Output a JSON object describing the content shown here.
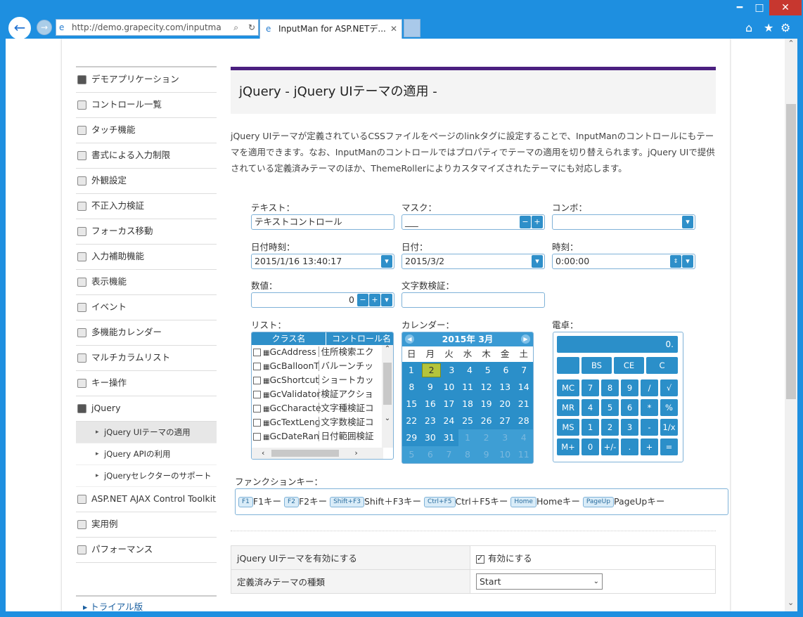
{
  "browser": {
    "url": "http://demo.grapecity.com/inputma",
    "tab_title": "InputMan for ASP.NETデ...",
    "tab_close": "✕",
    "window_controls": {
      "minimize": "━",
      "maximize": "□",
      "close": "✕"
    },
    "icons": [
      "home-icon",
      "favorites-icon",
      "tools-icon"
    ]
  },
  "sidebar": {
    "items": [
      {
        "label": "デモアプリケーション"
      },
      {
        "label": "コントロール一覧"
      },
      {
        "label": "タッチ機能"
      },
      {
        "label": "書式による入力制限"
      },
      {
        "label": "外観設定"
      },
      {
        "label": "不正入力検証"
      },
      {
        "label": "フォーカス移動"
      },
      {
        "label": "入力補助機能"
      },
      {
        "label": "表示機能"
      },
      {
        "label": "イベント"
      },
      {
        "label": "多機能カレンダー"
      },
      {
        "label": "マルチカラムリスト"
      },
      {
        "label": "キー操作"
      },
      {
        "label": "jQuery"
      }
    ],
    "sub_items": [
      {
        "label": "jQuery UIテーマの適用"
      },
      {
        "label": "jQuery APIの利用"
      },
      {
        "label": "jQueryセレクターのサポート"
      }
    ],
    "more_items": [
      {
        "label": "ASP.NET AJAX Control Toolkit"
      },
      {
        "label": "実用例"
      },
      {
        "label": "パフォーマンス"
      }
    ],
    "trial": "トライアル版"
  },
  "main": {
    "title": "jQuery - jQuery UIテーマの適用 -",
    "description": "jQuery UIテーマが定義されているCSSファイルをページのlinkタグに設定することで、InputManのコントロールにもテーマを適用できます。なお、InputManのコントロールではプロパティでテーマの適用を切り替えられます。jQuery UIで提供されている定義済みテーマのほか、ThemeRollerによりカスタマイズされたテーマにも対応します。"
  },
  "form": {
    "text_label": "テキスト：",
    "text_value": "テキストコントロール",
    "mask_label": "マスク：",
    "mask_value": "___",
    "combo_label": "コンボ：",
    "datetime_label": "日付時刻：",
    "datetime_value": "2015/1/16 13:40:17",
    "date_label": "日付：",
    "date_value": "2015/3/2",
    "time_label": "時刻：",
    "time_value": "0:00:00",
    "number_label": "数値：",
    "number_value": "0",
    "charcount_label": "文字数検証：",
    "list_label": "リスト：",
    "calendar_label": "カレンダー：",
    "calc_label": "電卓：",
    "fkeys_label": "ファンクションキー："
  },
  "list": {
    "headers": [
      "クラス名",
      "コントロール名"
    ],
    "rows": [
      {
        "cls": "GcAddress",
        "name": "住所検索エク"
      },
      {
        "cls": "GcBalloonT",
        "name": "バルーンチッ"
      },
      {
        "cls": "GcShortcut",
        "name": "ショートカッ"
      },
      {
        "cls": "GcValidator",
        "name": "検証アクショ"
      },
      {
        "cls": "GcCharacte",
        "name": "文字種検証コ"
      },
      {
        "cls": "GcTextLeng",
        "name": "文字数検証コ"
      },
      {
        "cls": "GcDateRan",
        "name": "日付範囲検証"
      }
    ]
  },
  "calendar": {
    "title": "2015年 3月",
    "days": [
      "日",
      "月",
      "火",
      "水",
      "木",
      "金",
      "土"
    ],
    "weeks": [
      [
        "1",
        "2",
        "3",
        "4",
        "5",
        "6",
        "7"
      ],
      [
        "8",
        "9",
        "10",
        "11",
        "12",
        "13",
        "14"
      ],
      [
        "15",
        "16",
        "17",
        "18",
        "19",
        "20",
        "21"
      ],
      [
        "22",
        "23",
        "24",
        "25",
        "26",
        "27",
        "28"
      ],
      [
        "29",
        "30",
        "31",
        "1",
        "2",
        "3",
        "4"
      ],
      [
        "5",
        "6",
        "7",
        "8",
        "9",
        "10",
        "11"
      ]
    ],
    "selected": "2"
  },
  "calculator": {
    "display": "0.",
    "rows": [
      [
        "",
        "BS",
        "CE",
        "C"
      ],
      [
        "MC",
        "7",
        "8",
        "9",
        "/",
        "√"
      ],
      [
        "MR",
        "4",
        "5",
        "6",
        "*",
        "%"
      ],
      [
        "MS",
        "1",
        "2",
        "3",
        "-",
        "1/x"
      ],
      [
        "M+",
        "0",
        "+/-",
        ".",
        "+",
        "="
      ]
    ]
  },
  "function_keys": [
    {
      "key": "F1",
      "label": "F1キー"
    },
    {
      "key": "F2",
      "label": "F2キー"
    },
    {
      "key": "Shift+F3",
      "label": "Shift＋F3キー"
    },
    {
      "key": "Ctrl+F5",
      "label": "Ctrl＋F5キー"
    },
    {
      "key": "Home",
      "label": "Homeキー"
    },
    {
      "key": "PageUp",
      "label": "PageUpキー"
    }
  ],
  "settings": {
    "enable_label": "jQuery UIテーマを有効にする",
    "enable_text": "有効にする",
    "enable_checked": true,
    "theme_label": "定義済みテーマの種類",
    "theme_value": "Start"
  },
  "colors": {
    "accent": "#2e8fc9",
    "title_bar": "#4b2080",
    "chrome": "#1e8fe0"
  }
}
